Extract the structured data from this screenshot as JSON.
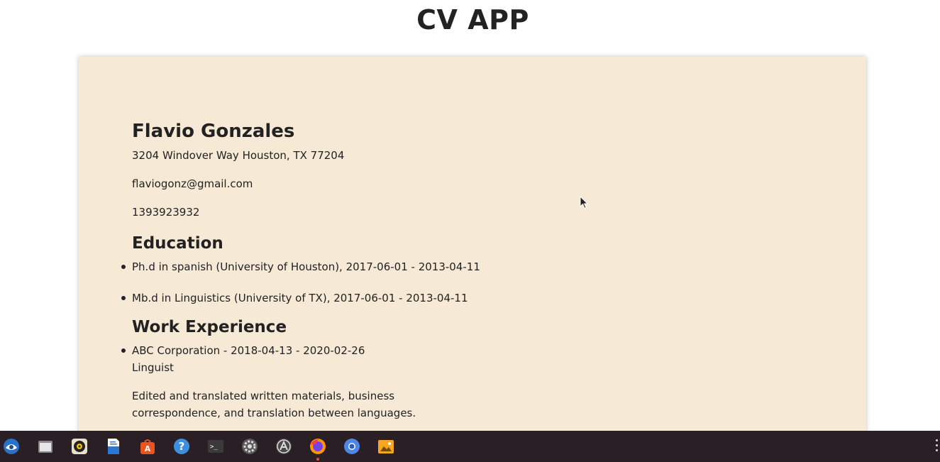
{
  "app": {
    "title": "CV APP"
  },
  "cv": {
    "name": "Flavio Gonzales",
    "address": "3204 Windover Way Houston, TX 77204",
    "email": "flaviogonz@gmail.com",
    "phone": "1393923932",
    "education_title": "Education",
    "education": [
      "Ph.d in spanish (University of Houston), 2017-06-01 - 2013-04-11",
      "Mb.d in Linguistics (University of TX), 2017-06-01 - 2013-04-11"
    ],
    "work_title": "Work Experience",
    "work": [
      {
        "header": "ABC Corporation - 2018-04-13 - 2020-02-26",
        "role": "Linguist",
        "description": "Edited and translated written materials, business correspondence, and translation between languages."
      }
    ]
  },
  "taskbar": {
    "icons": [
      "thunderbird-icon",
      "files-icon",
      "rhythmbox-icon",
      "writer-icon",
      "software-center-icon",
      "help-icon",
      "terminal-icon",
      "settings-icon",
      "app-store-icon",
      "firefox-icon",
      "chromium-icon",
      "image-viewer-icon"
    ],
    "active": "firefox-icon",
    "colors": {
      "background": "#2b1f26",
      "accent": "#e95420"
    }
  },
  "colors": {
    "card_background": "#f6e9d6",
    "text": "#222222"
  }
}
